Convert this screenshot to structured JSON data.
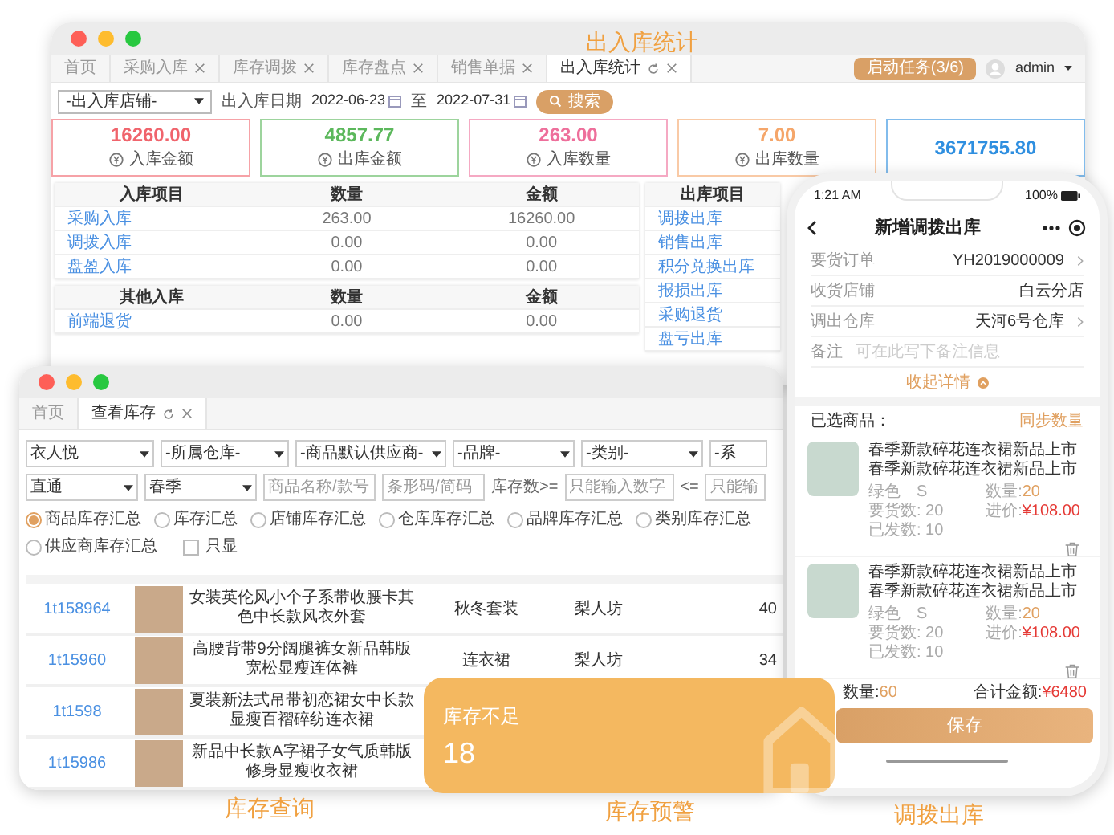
{
  "captions": [
    "出入库统计",
    "库存查询",
    "库存预警",
    "调拨出库"
  ],
  "stats_window": {
    "tabs": [
      {
        "label": "首页",
        "selected": false,
        "closable": false
      },
      {
        "label": "采购入库",
        "selected": false,
        "closable": true
      },
      {
        "label": "库存调拨",
        "selected": false,
        "closable": true
      },
      {
        "label": "库存盘点",
        "selected": false,
        "closable": true
      },
      {
        "label": "销售单据",
        "selected": false,
        "closable": true
      },
      {
        "label": "出入库统计",
        "selected": true,
        "closable": true
      }
    ],
    "task_button": "启动任务(3/6)",
    "user": "admin",
    "filters": {
      "store_select": "-出入库店铺-",
      "date_label": "出入库日期",
      "date_from": "2022-06-23",
      "date_sep": "至",
      "date_to": "2022-07-31",
      "search_button": "搜索"
    },
    "stats": [
      {
        "value": "16260.00",
        "label": "入库金额",
        "color": "#f0646c"
      },
      {
        "value": "4857.77",
        "label": "出库金额",
        "color": "#5cb85c"
      },
      {
        "value": "263.00",
        "label": "入库数量",
        "color": "#ee6f9b"
      },
      {
        "value": "7.00",
        "label": "出库数量",
        "color": "#f5a66a"
      },
      {
        "value": "3671755.80",
        "color": "#2f8fe0"
      }
    ],
    "in_table": {
      "columns": [
        "入库项目",
        "数量",
        "金额"
      ],
      "rows": [
        [
          "采购入库",
          "263.00",
          "16260.00"
        ],
        [
          "调拨入库",
          "0.00",
          "0.00"
        ],
        [
          "盘盈入库",
          "0.00",
          "0.00"
        ]
      ]
    },
    "other_in_table": {
      "columns": [
        "其他入库",
        "数量",
        "金额"
      ],
      "rows": [
        [
          "前端退货",
          "0.00",
          "0.00"
        ]
      ]
    },
    "out_table": {
      "columns": [
        "出库项目"
      ],
      "rows": [
        [
          "调拨出库"
        ],
        [
          "销售出库"
        ],
        [
          "积分兑换出库"
        ],
        [
          "报损出库"
        ],
        [
          "采购退货"
        ],
        [
          "盘亏出库"
        ]
      ]
    }
  },
  "inventory_window": {
    "tabs": [
      {
        "label": "首页",
        "selected": false,
        "closable": false
      },
      {
        "label": "查看库存",
        "selected": true,
        "closable": true
      }
    ],
    "filter_row_1": [
      "衣人悦",
      "-所属仓库-",
      "-商品默认供应商-",
      "-品牌-",
      "-类别-",
      "-系"
    ],
    "filter_row_2": [
      {
        "kind": "select",
        "value": "直通"
      },
      {
        "kind": "select",
        "value": "春季"
      },
      {
        "kind": "input",
        "placeholder": "商品名称/款号"
      },
      {
        "kind": "input",
        "placeholder": "条形码/简码"
      },
      {
        "kind": "label",
        "text": "库存数>="
      },
      {
        "kind": "input",
        "placeholder": "只能输入数字"
      },
      {
        "kind": "label",
        "text": "<="
      },
      {
        "kind": "input",
        "placeholder": "只能输"
      }
    ],
    "summary_options": [
      {
        "label": "商品库存汇总",
        "selected": true
      },
      {
        "label": "库存汇总",
        "selected": false
      },
      {
        "label": "店铺库存汇总",
        "selected": false
      },
      {
        "label": "仓库库存汇总",
        "selected": false
      },
      {
        "label": "品牌库存汇总",
        "selected": false
      },
      {
        "label": "类别库存汇总",
        "selected": false
      },
      {
        "label": "供应商库存汇总",
        "selected": false
      }
    ],
    "only_show": {
      "label": "只显",
      "checked": false
    },
    "rows": [
      {
        "code": "1t158964",
        "name": "女装英伦风小个子系带收腰卡其色中长款风衣外套",
        "category": "秋冬套装",
        "brand": "梨人坊",
        "quantity": "40"
      },
      {
        "code": "1t15960",
        "name": "高腰背带9分阔腿裤女新品韩版宽松显瘦连体裤",
        "category": "连衣裙",
        "brand": "梨人坊",
        "quantity": "34"
      },
      {
        "code": "1t1598",
        "name": "夏装新法式吊带初恋裙女中长款显瘦百褶碎纺连衣裙"
      },
      {
        "code": "1t15986",
        "name": "新品中长款A字裙子女气质韩版修身显瘦收衣裙"
      }
    ]
  },
  "alert_card": {
    "label": "库存不足",
    "value": "18"
  },
  "phone": {
    "time": "1:21 AM",
    "battery": "100%",
    "title": "新增调拨出库",
    "fields": [
      {
        "kind": "value",
        "label": "要货订单",
        "value": "YH2019000009",
        "arrow": true
      },
      {
        "kind": "value",
        "label": "收货店铺",
        "value": "白云分店",
        "arrow": false
      },
      {
        "kind": "value",
        "label": "调出仓库",
        "value": "天河6号仓库",
        "arrow": true
      },
      {
        "kind": "input",
        "label": "备注",
        "placeholder": "可在此写下备注信息"
      }
    ],
    "collapse_link": "收起详情",
    "selected_label": "已选商品：",
    "sync_link": "同步数量",
    "products": [
      {
        "name": "春季新款碎花连衣裙新品上市春季新款碎花连衣裙新品上市",
        "spec": "绿色　S",
        "requested": "要货数: 20",
        "shipped": "已发数: 10",
        "qty_label": "数量:",
        "qty": "20",
        "price_label": "进价:",
        "price": "¥108.00"
      },
      {
        "name": "春季新款碎花连衣裙新品上市春季新款碎花连衣裙新品上市",
        "spec": "绿色　S",
        "requested": "要货数: 20",
        "shipped": "已发数: 10",
        "qty_label": "数量:",
        "qty": "20",
        "price_label": "进价:",
        "price": "¥108.00"
      }
    ],
    "total_qty_label": "数量:",
    "total_qty": "60",
    "total_amount_label": "合计金额:",
    "total_amount": "¥6480",
    "save_button": "保存"
  }
}
